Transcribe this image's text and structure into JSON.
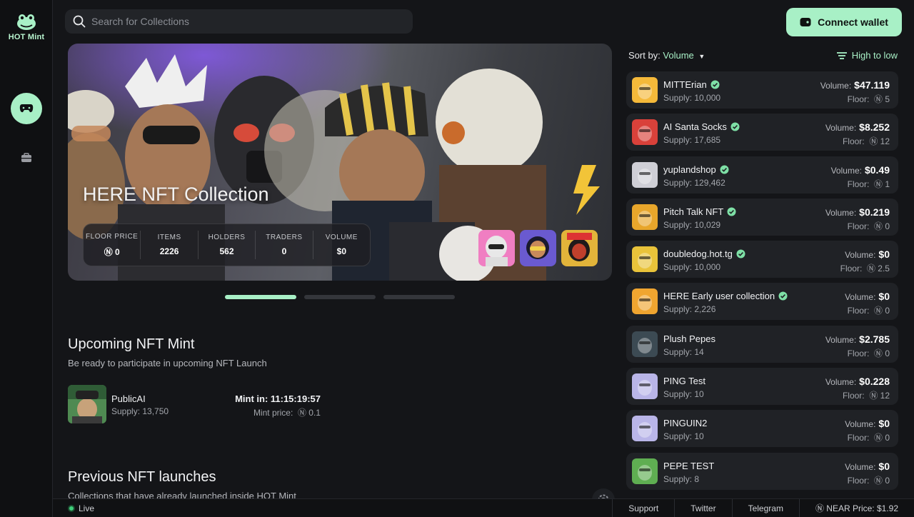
{
  "app": {
    "logo_text": "HOT Mint"
  },
  "search": {
    "placeholder": "Search for Collections"
  },
  "header": {
    "connect_label": "Connect wallet"
  },
  "hero": {
    "title": "HERE NFT Collection",
    "stats": [
      {
        "label": "FLOOR PRICE",
        "value": "Ⓝ 0"
      },
      {
        "label": "ITEMS",
        "value": "2226"
      },
      {
        "label": "HOLDERS",
        "value": "562"
      },
      {
        "label": "TRADERS",
        "value": "0"
      },
      {
        "label": "VOLUME",
        "value": "$0"
      }
    ],
    "active_slide": 1,
    "slide_count": 3
  },
  "upcoming": {
    "title": "Upcoming NFT Mint",
    "subtitle": "Be ready to participate in upcoming NFT Launch",
    "item": {
      "name": "PublicAI",
      "supply": "Supply: 13,750",
      "mint_in": "Mint in: 11:15:19:57",
      "mint_price_label": "Mint price:",
      "mint_price": "Ⓝ 0.1"
    }
  },
  "previous": {
    "title": "Previous NFT launches",
    "subtitle": "Collections that have already launched inside HOT Mint"
  },
  "sort": {
    "label": "Sort by:",
    "value": "Volume",
    "order": "High to low"
  },
  "collections": [
    {
      "name": "MITTErian",
      "verified": true,
      "supply": "Supply: 10,000",
      "volume": "$47.119",
      "floor": "Ⓝ 5",
      "color": "#f5b93a"
    },
    {
      "name": "AI Santa Socks",
      "verified": true,
      "supply": "Supply: 17,685",
      "volume": "$8.252",
      "floor": "Ⓝ 12",
      "color": "#d9413a"
    },
    {
      "name": "yuplandshop",
      "verified": true,
      "supply": "Supply: 129,462",
      "volume": "$0.49",
      "floor": "Ⓝ 1",
      "color": "#cfcfd6"
    },
    {
      "name": "Pitch Talk NFT",
      "verified": true,
      "supply": "Supply: 10,029",
      "volume": "$0.219",
      "floor": "Ⓝ 0",
      "color": "#e8a62b"
    },
    {
      "name": "doubledog.hot.tg",
      "verified": true,
      "supply": "Supply: 10,000",
      "volume": "$0",
      "floor": "Ⓝ 2.5",
      "color": "#e9c33a"
    },
    {
      "name": "HERE Early user collection",
      "verified": true,
      "supply": "Supply: 2,226",
      "volume": "$0",
      "floor": "Ⓝ 0",
      "color": "#f0a530"
    },
    {
      "name": "Plush Pepes",
      "verified": false,
      "supply": "Supply: 14",
      "volume": "$2.785",
      "floor": "Ⓝ 0",
      "color": "#3c4a53"
    },
    {
      "name": "PING Test",
      "verified": false,
      "supply": "Supply: 10",
      "volume": "$0.228",
      "floor": "Ⓝ 12",
      "color": "#b9b5e8"
    },
    {
      "name": "PINGUIN2",
      "verified": false,
      "supply": "Supply: 10",
      "volume": "$0",
      "floor": "Ⓝ 0",
      "color": "#b9b5e8"
    },
    {
      "name": "PEPE TEST",
      "verified": false,
      "supply": "Supply: 8",
      "volume": "$0",
      "floor": "Ⓝ 0",
      "color": "#5fae52"
    }
  ],
  "labels": {
    "volume": "Volume:",
    "floor": "Floor:"
  },
  "footer": {
    "status": "Live",
    "links": [
      "Support",
      "Twitter",
      "Telegram"
    ],
    "near_price": "Ⓝ NEAR Price: $1.92"
  },
  "colors": {
    "accent": "#a8f0c6",
    "background": "#141518",
    "card": "#202226",
    "verified": "#7ee0a6"
  }
}
